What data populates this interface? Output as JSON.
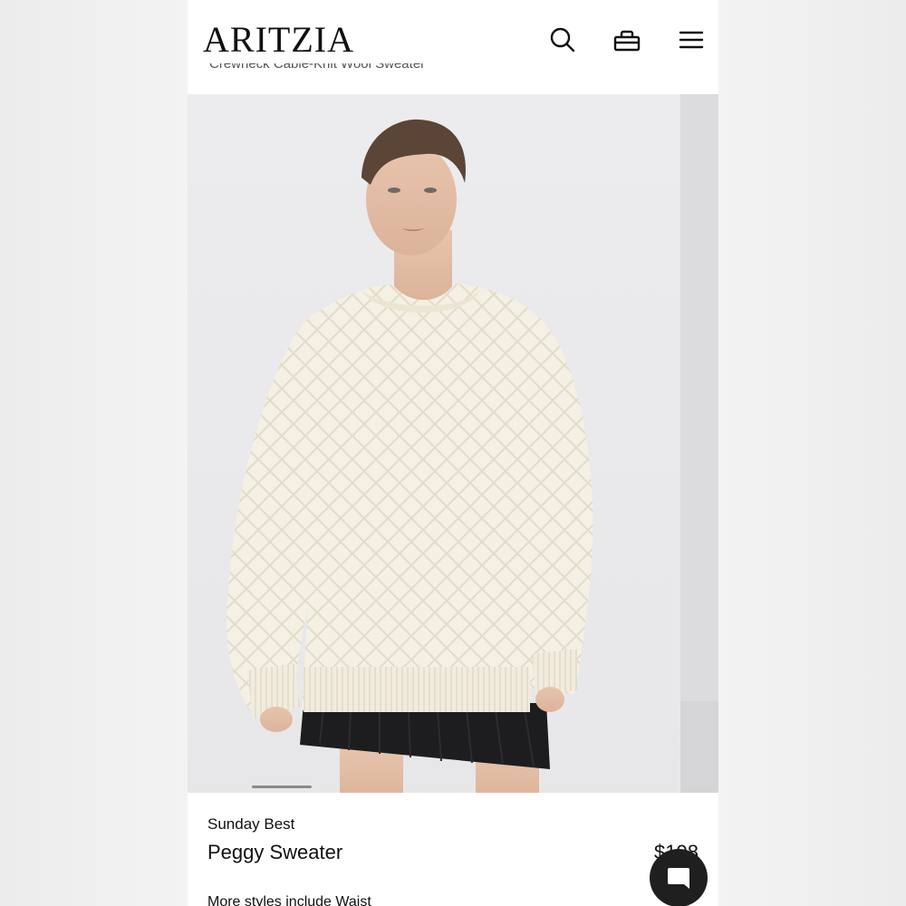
{
  "header": {
    "logo": "ARITZIA",
    "subtitle_cut": "Crewneck Cable-Knit Wool Sweater"
  },
  "icons": {
    "search": "search-icon",
    "bag": "shopping-bag-icon",
    "menu": "hamburger-menu-icon",
    "chat": "chat-bubble-icon"
  },
  "gallery": {
    "image_alt": "Model wearing cream cable-knit crewneck sweater with black pleated mini skirt"
  },
  "product": {
    "brand": "Sunday Best",
    "name": "Peggy Sweater",
    "price": "$198",
    "more_styles": "More styles include Waist"
  },
  "colors": {
    "sweater": "#f3efe2",
    "skirt": "#1d1d1f",
    "background": "#e9e9eb",
    "chat_button": "#1f1f1f"
  }
}
